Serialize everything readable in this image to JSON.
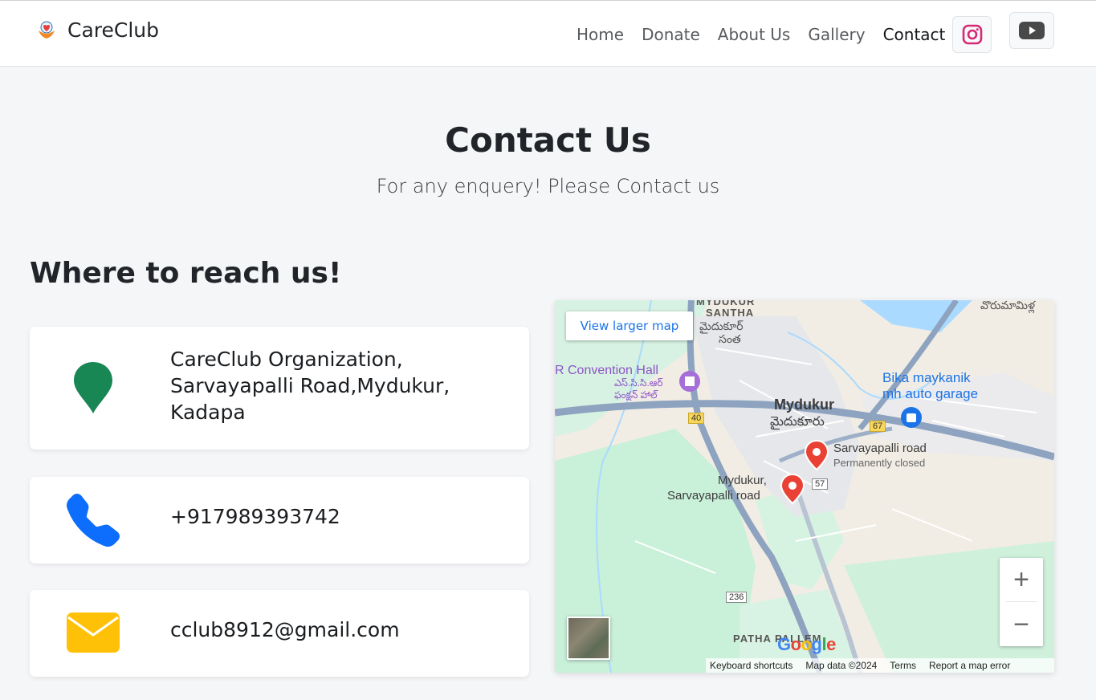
{
  "brand": {
    "name": "CareClub",
    "logo_icon": "hands-heart-icon"
  },
  "nav": {
    "items": [
      {
        "label": "Home",
        "active": false
      },
      {
        "label": "Donate",
        "active": false
      },
      {
        "label": "About Us",
        "active": false
      },
      {
        "label": "Gallery",
        "active": false
      },
      {
        "label": "Contact",
        "active": true
      }
    ],
    "social": [
      {
        "icon": "instagram-icon",
        "color": "#d62976"
      },
      {
        "icon": "youtube-icon",
        "color": "#494949"
      }
    ]
  },
  "hero": {
    "title": "Contact Us",
    "subtitle": "For any enquery! Please Contact us"
  },
  "contact": {
    "heading": "Where to reach us!",
    "address": {
      "icon": "location-pin-icon",
      "color": "#198754",
      "text": "CareClub Organization, Sarvayapalli Road,Mydukur, Kadapa"
    },
    "phone": {
      "icon": "phone-icon",
      "color": "#0d6efd",
      "text": "+917989393742"
    },
    "email": {
      "icon": "envelope-icon",
      "color": "#ffc107",
      "text": "cclub8912@gmail.com"
    }
  },
  "map": {
    "view_larger": "View larger map",
    "labels": {
      "santha_1": "MYDUKUR",
      "santha_2": "SANTHA",
      "santha_te": "మైదుకూర్",
      "santha_te2": "సంత",
      "convention": "R Convention Hall",
      "convention_te": "ఎస్.సి.సి.ఆర్",
      "convention_te2": "ఫంక్షన్ హాల్",
      "town": "Mydukur",
      "town_te": "మైదుకూరు",
      "garage_1": "Bika maykanik",
      "garage_2": "mh auto garage",
      "place_1": "Sarvayapalli road",
      "place_1_status": "Permanently closed",
      "place_2a": "Mydukur,",
      "place_2b": "Sarvayapalli road",
      "patha": "PATHA PALLEM",
      "top_right_te": "వొరుమామిళ్ల",
      "road_40": "40",
      "road_67": "67",
      "road_57": "57",
      "road_236": "236"
    },
    "zoom_in": "+",
    "zoom_out": "−",
    "footer": {
      "shortcuts": "Keyboard shortcuts",
      "data": "Map data ©2024",
      "terms": "Terms",
      "report": "Report a map error"
    },
    "google": [
      "G",
      "o",
      "o",
      "g",
      "l",
      "e"
    ]
  }
}
